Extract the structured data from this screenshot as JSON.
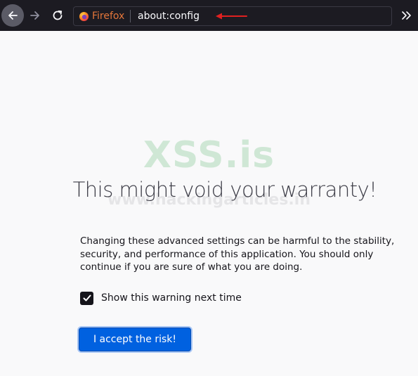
{
  "toolbar": {
    "back_icon": "back-arrow-icon",
    "forward_icon": "forward-arrow-icon",
    "reload_icon": "reload-icon",
    "identity_label": "Firefox",
    "url": "about:config",
    "overflow_icon": "double-chevron-icon",
    "annotation_color": "#e02020"
  },
  "watermark": {
    "main": "XSS.is",
    "sub": "www.hackingarticles.in"
  },
  "warning": {
    "title": "This might void your warranty!",
    "description": "Changing these advanced settings can be harmful to the stability, security, and performance of this application. You should only continue if you are sure of what you are doing.",
    "checkbox_label": "Show this warning next time",
    "checkbox_checked": true,
    "accept_button": "I accept the risk!"
  },
  "colors": {
    "accent": "#0061e0",
    "toolbar_bg": "#1c1b22",
    "page_bg": "#f9f9fa"
  }
}
